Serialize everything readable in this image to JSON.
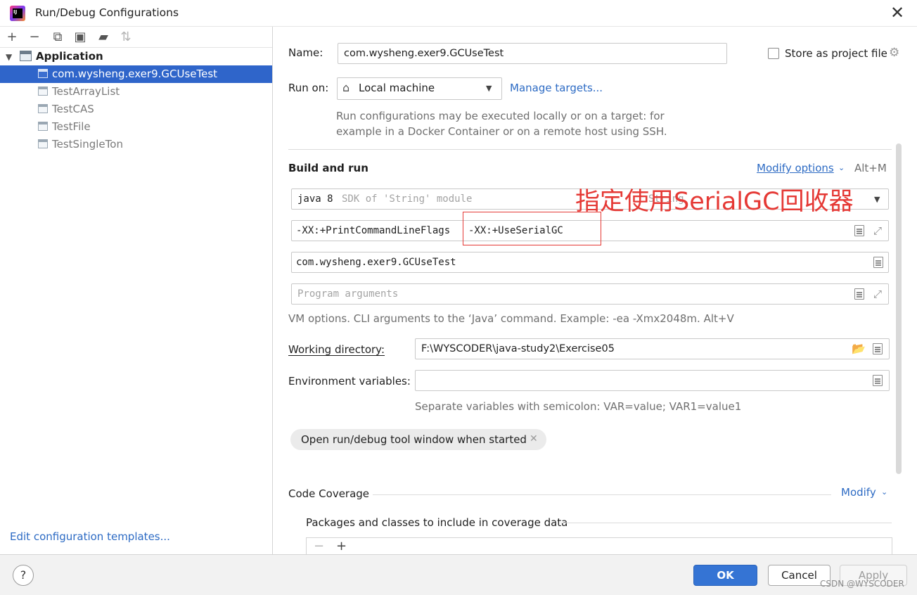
{
  "window": {
    "title": "Run/Debug Configurations"
  },
  "left_panel": {
    "toolbar": [
      "plus-icon",
      "minus-icon",
      "copy-icon",
      "save-icon",
      "folder-add-icon",
      "sort-icon"
    ],
    "tree": {
      "group": "Application",
      "items": [
        {
          "label": "com.wysheng.exer9.GCUseTest",
          "selected": true
        },
        {
          "label": "TestArrayList",
          "selected": false
        },
        {
          "label": "TestCAS",
          "selected": false
        },
        {
          "label": "TestFile",
          "selected": false
        },
        {
          "label": "TestSingleTon",
          "selected": false
        }
      ]
    },
    "edit_templates_link": "Edit configuration templates..."
  },
  "form": {
    "name_label": "Name:",
    "name_value": "com.wysheng.exer9.GCUseTest",
    "store_label": "Store as project file",
    "run_on_label": "Run on:",
    "run_on_value": "Local machine",
    "manage_targets": "Manage targets...",
    "run_on_hint_1": "Run configurations may be executed locally or on a target: for",
    "run_on_hint_2": "example in a Docker Container or on a remote host using SSH.",
    "build_and_run": "Build and run",
    "modify_options": "Modify options",
    "modify_shortcut": "Alt+M",
    "jre_value": "java 8",
    "jre_hint": "SDK of 'String' module",
    "jre_hint_right": "String",
    "vm_options_value_1": "-XX:+PrintCommandLineFlags",
    "vm_options_value_2": "-XX:+UseSerialGC",
    "main_class_value": "com.wysheng.exer9.GCUseTest",
    "program_args_placeholder": "Program arguments",
    "vm_hint": "VM options. CLI arguments to the ‘Java’ command. Example: -ea -Xmx2048m. Alt+V",
    "working_dir_label": "Working directory:",
    "working_dir_value": "F:\\WYSCODER\\java-study2\\Exercise05",
    "env_label": "Environment variables:",
    "env_hint": "Separate variables with semicolon: VAR=value; VAR1=value1",
    "chip_label": "Open run/debug tool window when started",
    "code_coverage": "Code Coverage",
    "modify": "Modify",
    "packages_label": "Packages and classes to include in coverage data"
  },
  "annotation": "指定使用SerialGC回收器",
  "buttons": {
    "ok": "OK",
    "cancel": "Cancel",
    "apply": "Apply",
    "help": "?"
  },
  "watermark": "CSDN @WYSCODER",
  "colors": {
    "selection": "#2f65ca",
    "link": "#2d6bc4",
    "ok_button": "#3574d4",
    "annotation": "#e53935"
  }
}
